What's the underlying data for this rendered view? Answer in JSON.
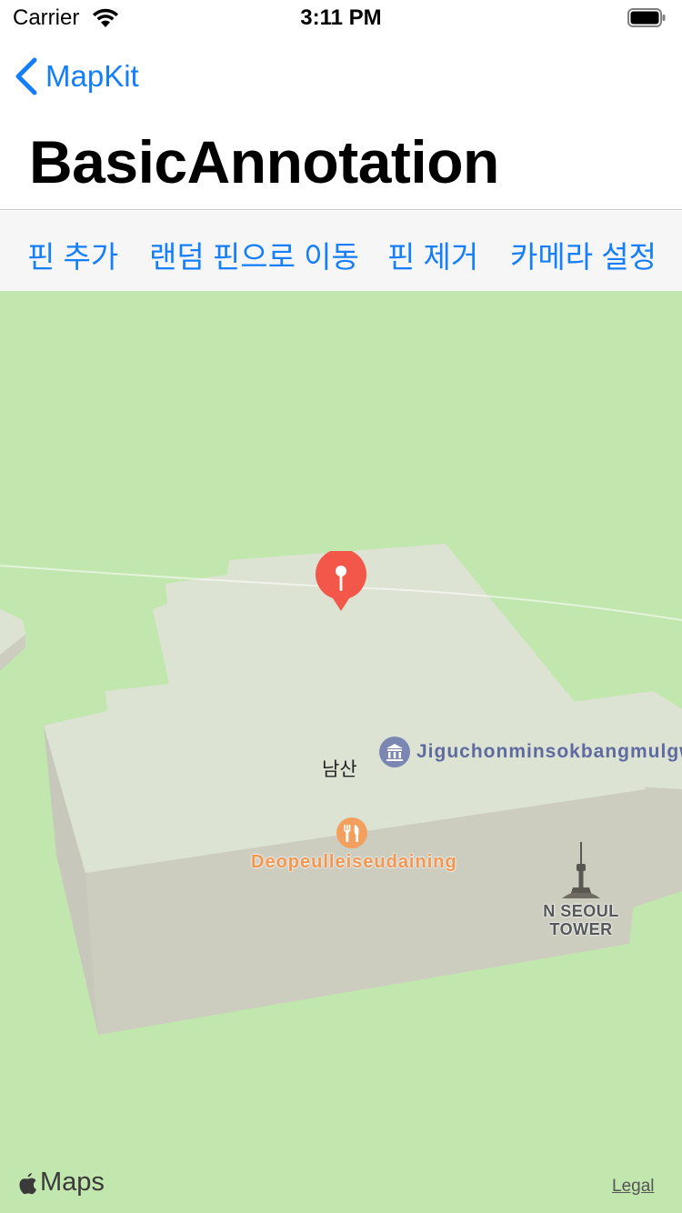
{
  "status_bar": {
    "carrier": "Carrier",
    "time": "3:11 PM"
  },
  "nav": {
    "back_label": "MapKit",
    "title": "BasicAnnotation"
  },
  "toolbar": {
    "add_pin": "핀 추가",
    "move_random_pin": "랜덤 핀으로 이동",
    "remove_pin": "핀 제거",
    "camera_settings": "카메라 설정"
  },
  "map": {
    "labels": {
      "namsan": "남산",
      "museum": "Jiguchonminsokbangmulgwan",
      "restaurant": "Deopeulleiseudaining",
      "tower": "N SEOUL TOWER"
    },
    "attribution": "Maps",
    "legal": "Legal",
    "colors": {
      "land": "#c2e7ae",
      "building_top": "#dde3d3",
      "building_side": "#ccccbf",
      "pin": "#f2574a"
    },
    "icons": [
      "museum-icon",
      "restaurant-icon",
      "tower-icon",
      "pin-icon",
      "apple-icon"
    ]
  }
}
